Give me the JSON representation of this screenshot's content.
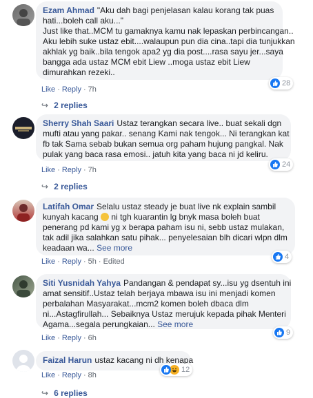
{
  "comments": [
    {
      "name": "Ezam Ahmad",
      "lines": [
        "\"Aku dah bagi penjelasan kalau korang tak puas",
        "hati...boleh call aku...\"",
        "Just like that..MCM tu gamaknya kamu nak lepaskan perbincangan..",
        "Aku lebih suke ustaz ebit....walaupun pun dia cina..tapi dia tunjukkan",
        "akhlak yg baik..bila tengok apa2 yg dia post....rasa sayu jer...saya",
        "bangga ada ustaz MCM ebit Liew ..moga ustaz ebit Liew",
        "dimurahkan rezeki.."
      ],
      "like": "Like",
      "reply": "Reply",
      "time": "7h",
      "reactions": "28",
      "replies": "2 replies"
    },
    {
      "name": "Sherry Shah Saari",
      "lines": [
        "Ustaz terangkan secara live.. buat sekali dgn",
        "mufti atau yang pakar.. senang Kami nak tengok... Ni terangkan kat",
        "fb tak Sama sebab bukan semua org paham hujung pangkal. Nak",
        "pulak yang baca rasa emosi.. jatuh kita yang baca ni jd keliru."
      ],
      "like": "Like",
      "reply": "Reply",
      "time": "7h",
      "reactions": "24",
      "replies": "2 replies"
    },
    {
      "name": "Latifah Omar",
      "lines": [
        "Selalu ustaz steady je buat live nk explain sambil",
        "kunyah kacang",
        "ni tgh kuarantin lg bnyk masa boleh buat",
        "penerang pd kami yg x berapa paham isu ni, sebb ustaz mulakan,",
        "tak adil jika salahkan satu pihak... penyelesaian blh dicari wlpn dlm",
        "keadaan wa..."
      ],
      "see_more": "See more",
      "like": "Like",
      "reply": "Reply",
      "time": "5h",
      "edited": "Edited",
      "reactions": "4"
    },
    {
      "name": "Siti Yusnidah Yahya",
      "lines": [
        "Pandangan & pendapat sy...isu yg dsentuh ini",
        "amat sensitif..Ustaz telah berjaya mbawa isu ini menjadi komen",
        "perbalahan Masyarakat...mcm2 komen boleh dbaca dlm",
        "ni...Astagfirullah... Sebaiknya Ustaz merujuk kepada pihak Menteri",
        "Agama...segala perungkaian..."
      ],
      "see_more": "See more",
      "like": "Like",
      "reply": "Reply",
      "time": "6h",
      "reactions": "9"
    },
    {
      "name": "Faizal Harun",
      "lines": [
        "ustaz kacang ni dh kenapa"
      ],
      "like": "Like",
      "reply": "Reply",
      "time": "8h",
      "reactions": "12"
    }
  ],
  "footer_replies": "6 replies",
  "colors": {
    "link": "#385898",
    "bubble": "#f2f3f5",
    "like_blue": "#1877f2"
  }
}
